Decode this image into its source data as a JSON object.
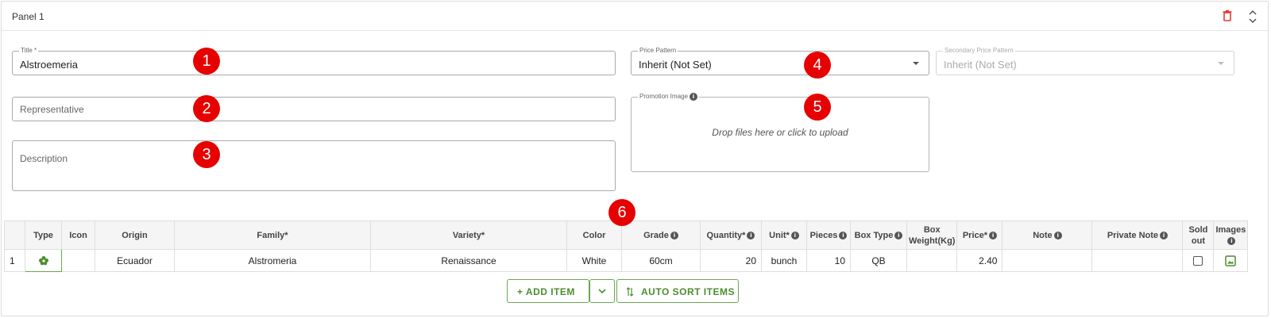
{
  "panel": {
    "title": "Panel 1",
    "delete_icon": "trash-icon",
    "collapse_icon": "collapse-icon"
  },
  "form": {
    "title_label": "Title *",
    "title_value": "Alstroemeria",
    "representative_placeholder": "Representative",
    "description_placeholder": "Description",
    "price_pattern_label": "Price Pattern",
    "price_pattern_value": "Inherit (Not Set)",
    "secondary_price_pattern_label": "Secondary Price Pattern",
    "secondary_price_pattern_value": "Inherit (Not Set)",
    "promotion_image_label": "Promotion Image",
    "promotion_image_drop_text": "Drop files here or click to upload"
  },
  "badges": [
    "1",
    "2",
    "3",
    "4",
    "5",
    "6"
  ],
  "table": {
    "headers": [
      "",
      "Type",
      "Icon",
      "Origin",
      "Family*",
      "Variety*",
      "Color",
      "Grade",
      "Quantity*",
      "Unit*",
      "Pieces",
      "Box Type",
      "Box Weight(Kg)",
      "Price*",
      "Note",
      "Private Note",
      "Sold out",
      "Images"
    ],
    "rows": [
      {
        "index": "1",
        "type_icon": "flower-icon",
        "icon": "",
        "origin": "Ecuador",
        "family": "Alstromeria",
        "variety": "Renaissance",
        "color": "White",
        "grade": "60cm",
        "quantity": "20",
        "unit": "bunch",
        "pieces": "10",
        "box_type": "QB",
        "box_weight": "",
        "price": "2.40",
        "note": "",
        "private_note": ""
      }
    ]
  },
  "actions": {
    "add_item": "+ ADD ITEM",
    "auto_sort": "AUTO SORT ITEMS"
  },
  "colors": {
    "accent_green": "#4d8c2f",
    "badge_red": "#e60000",
    "delete_red": "#e53935"
  }
}
